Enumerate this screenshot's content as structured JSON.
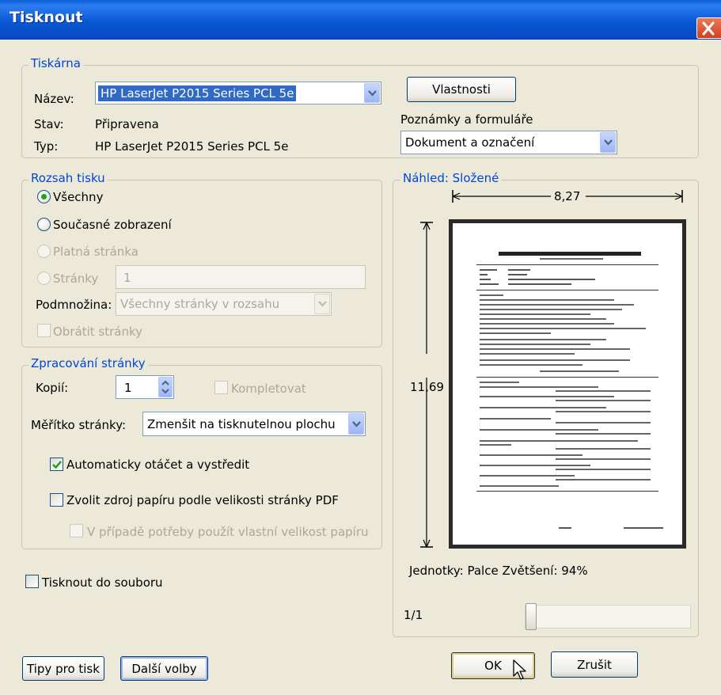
{
  "window": {
    "title": "Tisknout"
  },
  "printer": {
    "legend": "Tiskárna",
    "name_label": "Název:",
    "name_value": "HP LaserJet P2015 Series PCL 5e",
    "status_label": "Stav:",
    "status_value": "Připravena",
    "type_label": "Typ:",
    "type_value": "HP LaserJet P2015 Series PCL 5e",
    "properties_button": "Vlastnosti",
    "comments_label": "Poznámky a formuláře",
    "comments_value": "Dokument a označení"
  },
  "range": {
    "legend": "Rozsah tisku",
    "all": "Všechny",
    "current_view": "Současné zobrazení",
    "current_page": "Platná stránka",
    "pages": "Stránky",
    "pages_value": "1",
    "subset_label": "Podmnožina:",
    "subset_value": "Všechny stránky v rozsahu",
    "reverse": "Obrátit stránky",
    "selected": "Všechny"
  },
  "handling": {
    "legend": "Zpracování stránky",
    "copies_label": "Kopií:",
    "copies_value": "1",
    "collate": "Kompletovat",
    "scaling_label": "Měřítko stránky:",
    "scaling_value": "Zmenšit na tisknutelnou plochu",
    "auto_rotate": "Automaticky otáčet a vystředit",
    "auto_rotate_checked": true,
    "paper_source": "Zvolit zdroj papíru podle velikosti stránky PDF",
    "paper_source_checked": false,
    "custom_size": "V případě potřeby použít vlastní velikost papíru",
    "custom_size_checked": false
  },
  "print_to_file": {
    "label": "Tisknout do souboru",
    "checked": false
  },
  "preview": {
    "legend": "Náhled: Složené",
    "width": "8,27",
    "height": "11,69",
    "units_zoom": "Jednotky: Palce Zvětšení:  94%",
    "page_indicator": "1/1"
  },
  "buttons": {
    "tips": "Tipy pro tisk",
    "more_options": "Další volby",
    "ok": "OK",
    "cancel": "Zrušit"
  },
  "colors": {
    "titlebar": "#0a5fd8",
    "legend": "#0046d5",
    "radio_dot": "#21a121",
    "check_mark": "#21a121"
  }
}
